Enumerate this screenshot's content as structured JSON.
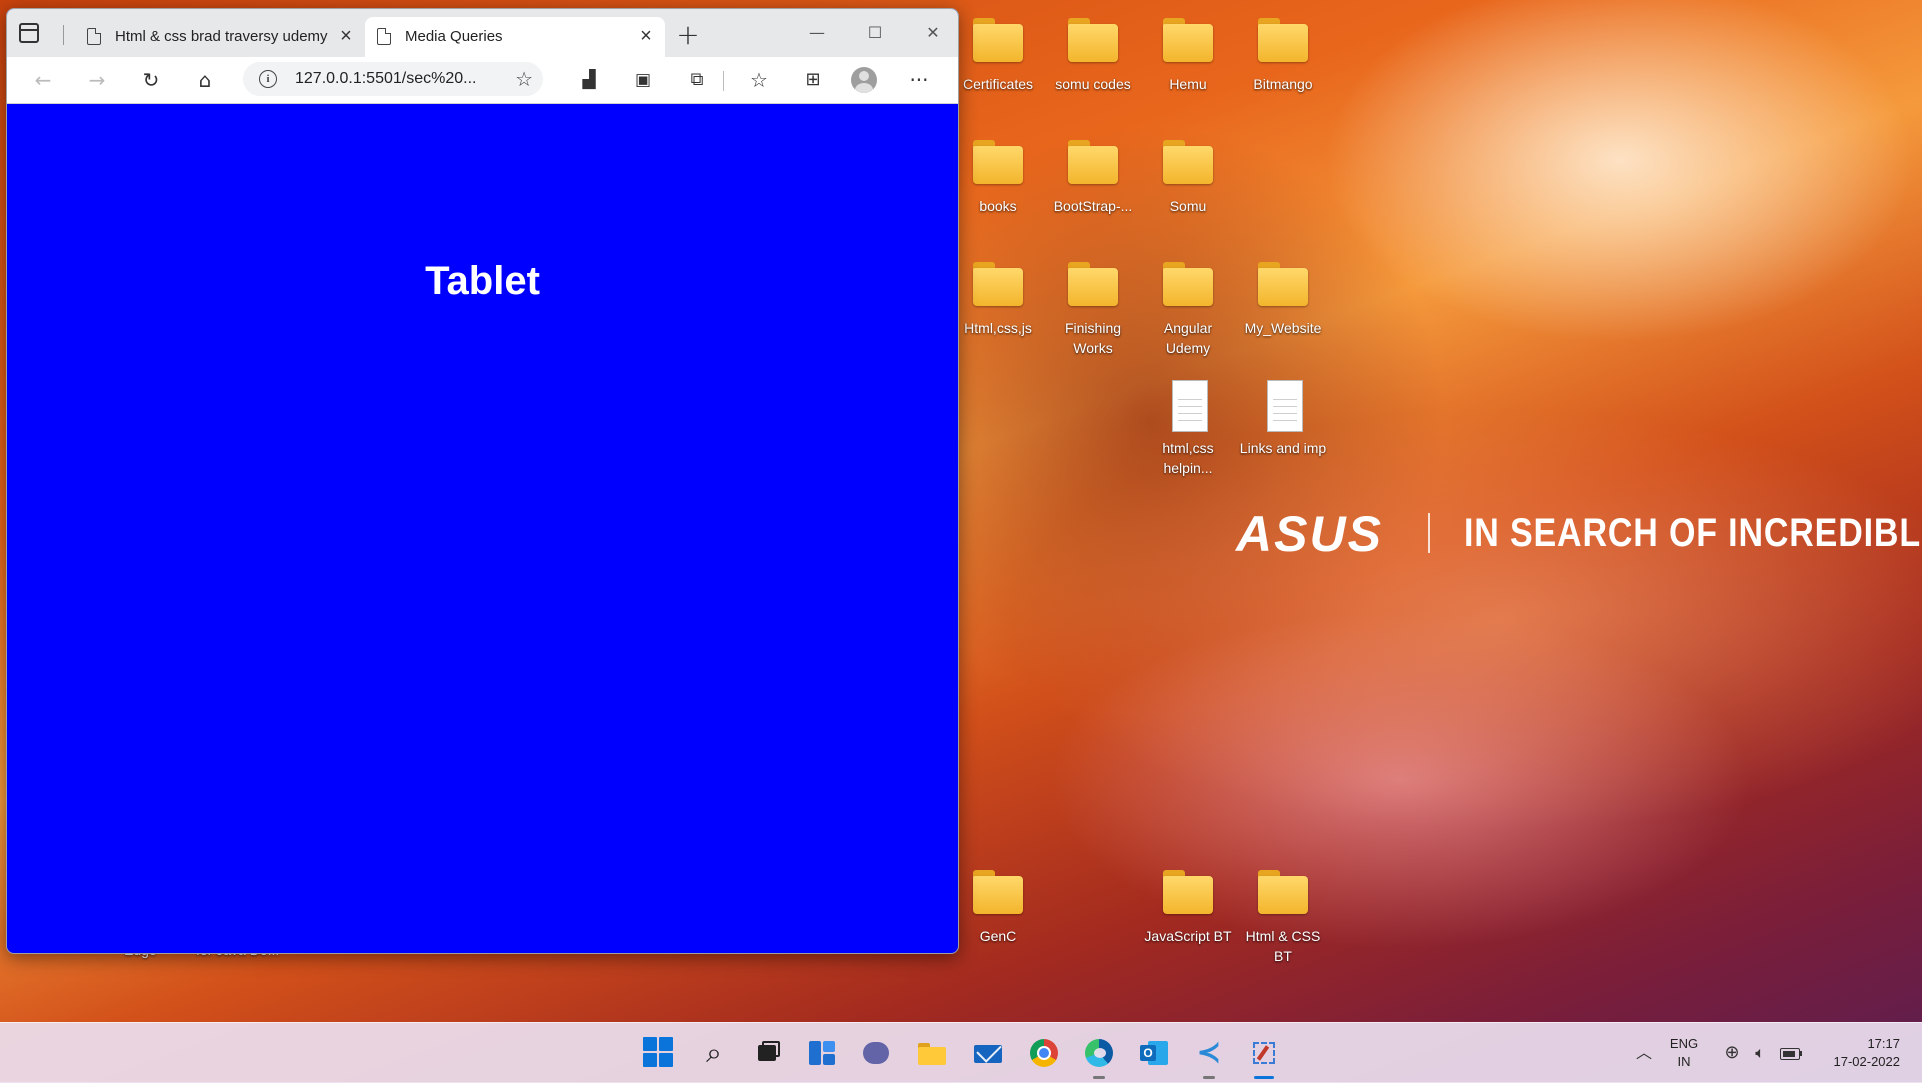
{
  "desktop": {
    "brand": {
      "logo": "ASUS",
      "tagline": "IN SEARCH OF INCREDIBLE"
    },
    "icons": [
      {
        "label": "Certificates",
        "type": "folder"
      },
      {
        "label": "somu codes",
        "type": "folder"
      },
      {
        "label": "Hemu",
        "type": "folder"
      },
      {
        "label": "Bitmango",
        "type": "folder"
      },
      {
        "label": "books",
        "type": "folder"
      },
      {
        "label": "BootStrap-...",
        "type": "folder"
      },
      {
        "label": "Somu",
        "type": "folder"
      },
      {
        "label": "Html,css,js",
        "type": "folder"
      },
      {
        "label": "Finishing Works",
        "type": "folder"
      },
      {
        "label": "Angular Udemy",
        "type": "folder"
      },
      {
        "label": "My_Website",
        "type": "folder"
      },
      {
        "label": "html,css helpin...",
        "type": "document"
      },
      {
        "label": "Links and imp",
        "type": "document"
      },
      {
        "label": "GenC",
        "type": "folder"
      },
      {
        "label": "JavaScript BT",
        "type": "folder"
      },
      {
        "label": "Html & CSS BT",
        "type": "folder"
      }
    ],
    "partial_labels": [
      "Edge",
      "for Java De..."
    ]
  },
  "browser": {
    "tabs": [
      {
        "title": "Html & css brad traversy udemy",
        "active": false
      },
      {
        "title": "Media Queries",
        "active": true
      }
    ],
    "new_tab": "+",
    "window_controls": {
      "minimize": "—",
      "maximize": "☐",
      "close": "✕"
    },
    "toolbar": {
      "back": "←",
      "forward": "→",
      "refresh": "↻",
      "home": "⌂",
      "url": "127.0.0.1:5501/sec%20...",
      "more": "···"
    },
    "page": {
      "heading": "Tablet",
      "background": "#0000ff"
    }
  },
  "taskbar": {
    "apps": [
      "start",
      "search",
      "task-view",
      "widgets",
      "teams-chat",
      "file-explorer",
      "mail",
      "chrome",
      "edge",
      "outlook",
      "vs-code",
      "snipping-tool"
    ],
    "tray": {
      "language_line1": "ENG",
      "language_line2": "IN",
      "time": "17:17",
      "date": "17-02-2022"
    }
  }
}
